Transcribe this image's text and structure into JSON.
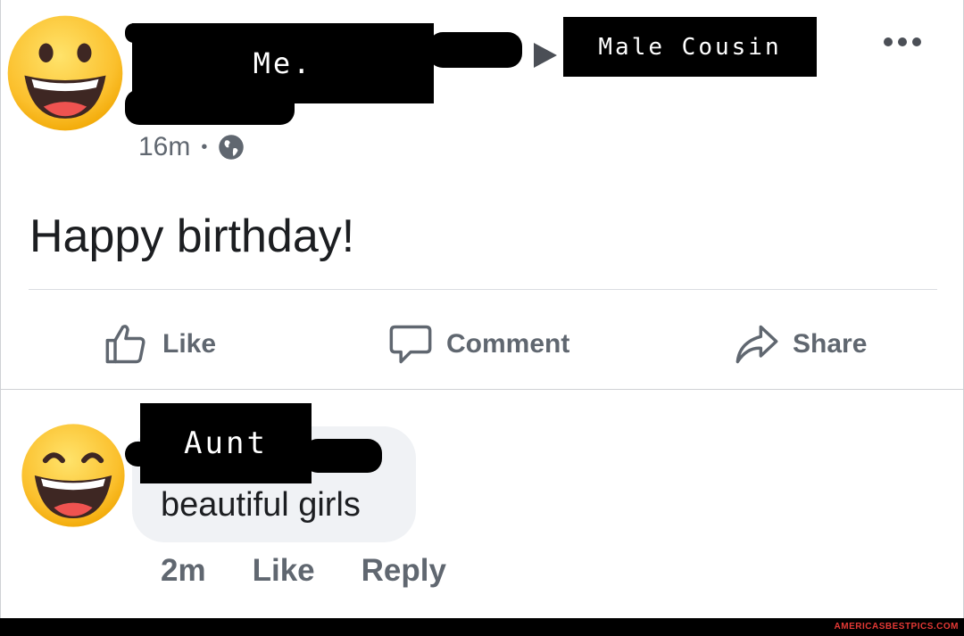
{
  "post": {
    "author_label": "Me.",
    "recipient_label": "Male Cousin",
    "time": "16m",
    "privacy_icon": "globe-icon",
    "text": "Happy birthday!",
    "actions": {
      "like": "Like",
      "comment": "Comment",
      "share": "Share"
    }
  },
  "comment": {
    "author_label": "Aunt",
    "text": "beautiful girls",
    "time": "2m",
    "like": "Like",
    "reply": "Reply"
  },
  "footer": {
    "watermark": "AMERICASBESTPICS.COM"
  },
  "colors": {
    "text": "#1c1e21",
    "secondary": "#606770",
    "bubble": "#f0f2f5",
    "emoji": "#fbc02d",
    "watermark": "#e53935"
  }
}
